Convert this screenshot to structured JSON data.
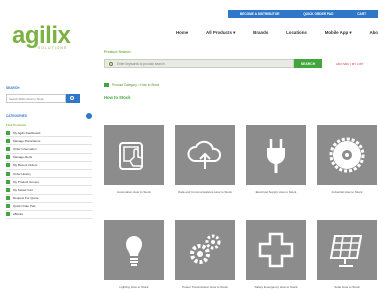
{
  "topbar": {
    "links": [
      "BECOME A DISTRIBUTOR",
      "QUICK ORDER PAD",
      "CART"
    ]
  },
  "logo": {
    "word": "agilix",
    "tagline": "SOLUTIONS"
  },
  "nav": [
    "Home",
    "All Products ▾",
    "Brands",
    "Locations",
    "Mobile App ▾",
    "Abo"
  ],
  "search": {
    "label": "Product Search",
    "placeholder": "Enter keywords to product search",
    "button": "SEARCH",
    "links": "ADV SRC | MY LIST"
  },
  "breadcrumb": "Product Category > How to Stock",
  "page_title": "How to Stock",
  "sidebar": {
    "search_head": "SEARCH",
    "search_placeholder": "Search Within How to Stock",
    "categories_head": "CATEGORIES",
    "sub_head": "Find Products",
    "items": [
      "My Agilix Dashboard",
      "Manage Plans/Items",
      "Order Information",
      "Manage Alerts",
      "My Recent Orders",
      "Order History",
      "My Product Groups",
      "My Saved Cart",
      "Request For Quote",
      "Quick Order Pad",
      "eBooks"
    ]
  },
  "cards": [
    {
      "icon": "touch-panel-icon",
      "label": "Automation How to Stock"
    },
    {
      "icon": "cloud-upload-icon",
      "label": "Data and Communications How to Stock"
    },
    {
      "icon": "power-plug-icon",
      "label": "Electrical Supply How to Stock"
    },
    {
      "icon": "saw-blade-icon",
      "label": "Industrial How to Stock"
    },
    {
      "icon": "light-bulb-icon",
      "label": "Lighting How to Stock"
    },
    {
      "icon": "gears-icon",
      "label": "Power Transmission How to Stock"
    },
    {
      "icon": "medical-cross-icon",
      "label": "Safety Emergency How to Stock"
    },
    {
      "icon": "solar-panel-icon",
      "label": "Solar How to Stock"
    }
  ]
}
